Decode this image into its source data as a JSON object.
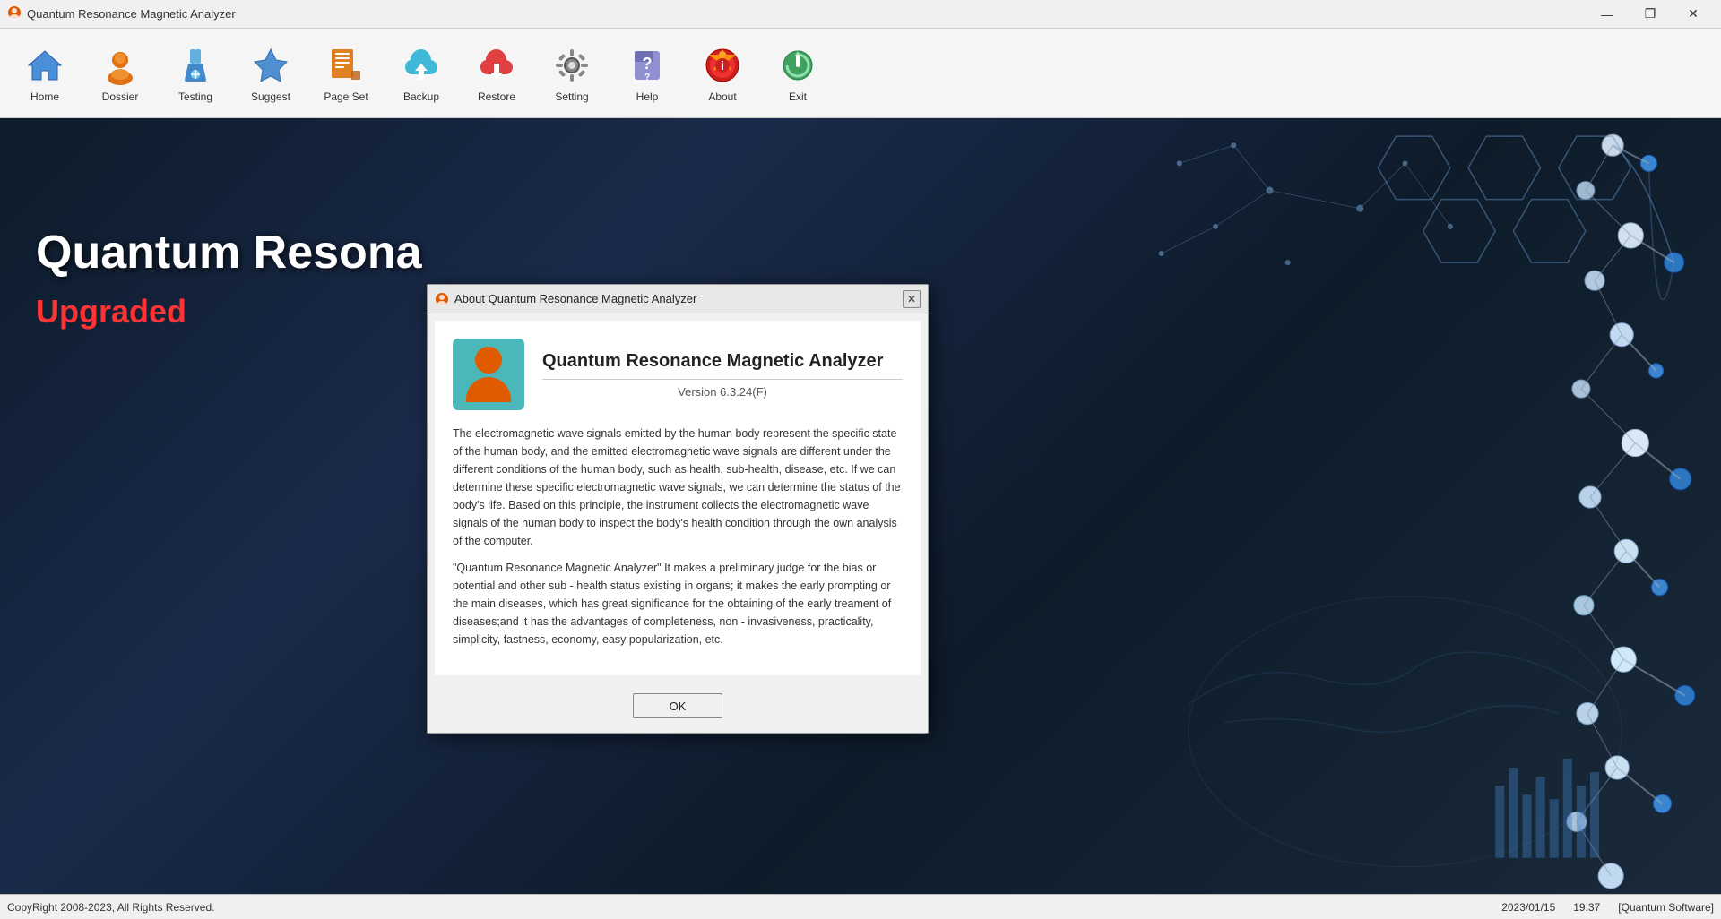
{
  "window": {
    "title": "Quantum Resonance Magnetic Analyzer",
    "icon": "app-icon"
  },
  "titlebar": {
    "controls": {
      "minimize": "—",
      "maximize": "❐",
      "close": "✕"
    }
  },
  "toolbar": {
    "items": [
      {
        "id": "home",
        "label": "Home"
      },
      {
        "id": "dossier",
        "label": "Dossier"
      },
      {
        "id": "testing",
        "label": "Testing"
      },
      {
        "id": "suggest",
        "label": "Suggest"
      },
      {
        "id": "page-set",
        "label": "Page Set"
      },
      {
        "id": "backup",
        "label": "Backup"
      },
      {
        "id": "restore",
        "label": "Restore"
      },
      {
        "id": "setting",
        "label": "Setting"
      },
      {
        "id": "help",
        "label": "Help"
      },
      {
        "id": "about",
        "label": "About"
      },
      {
        "id": "exit",
        "label": "Exit"
      }
    ]
  },
  "main": {
    "title_text": "Quantum Resona",
    "upgraded_text": "Upgraded"
  },
  "about_dialog": {
    "title": "About Quantum Resonance Magnetic Analyzer",
    "app_name": "Quantum Resonance Magnetic Analyzer",
    "version": "Version 6.3.24(F)",
    "description_para1": "The electromagnetic wave signals emitted by the human body represent the specific state of the human body, and the emitted electromagnetic wave signals are different under the different conditions of the human body, such as health, sub-health, disease, etc. If we can determine these specific electromagnetic wave signals, we can determine the status of the body's life. Based on this principle, the instrument collects the electromagnetic wave signals of the human body to inspect the body's health condition through the own analysis of the computer.",
    "description_para2": "\"Quantum Resonance Magnetic Analyzer\" It makes a preliminary judge for the bias or potential and other sub - health status existing in organs; it makes the early prompting or the main diseases, which has great significance for the obtaining of the early treament of diseases;and it has the advantages of completeness, non - invasiveness, practicality, simplicity, fastness, economy, easy popularization, etc.",
    "ok_label": "OK"
  },
  "statusbar": {
    "copyright": "CopyRight 2008-2023, All Rights Reserved.",
    "date": "2023/01/15",
    "time": "19:37",
    "software": "[Quantum Software]"
  }
}
